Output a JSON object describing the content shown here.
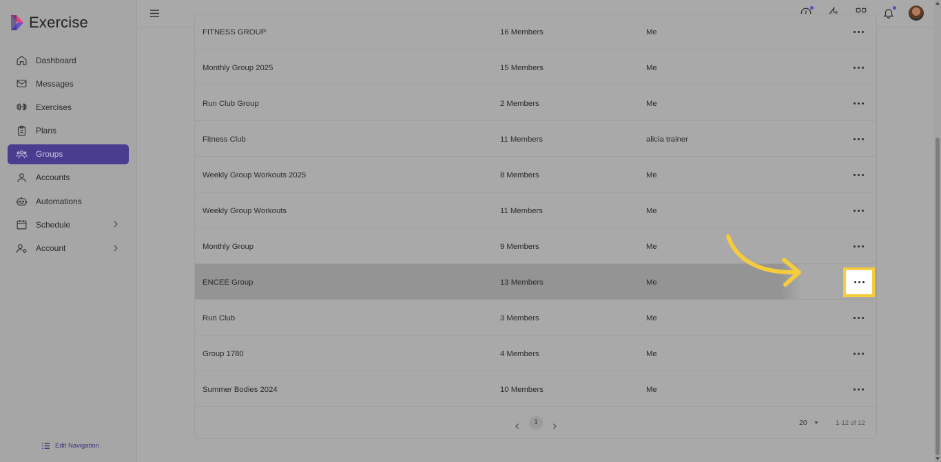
{
  "app": {
    "name": "Exercise"
  },
  "sidebar": {
    "items": [
      {
        "label": "Dashboard",
        "icon": "home-icon"
      },
      {
        "label": "Messages",
        "icon": "mail-icon"
      },
      {
        "label": "Exercises",
        "icon": "dumbbell-icon"
      },
      {
        "label": "Plans",
        "icon": "clipboard-icon"
      },
      {
        "label": "Groups",
        "icon": "users-icon",
        "active": true
      },
      {
        "label": "Accounts",
        "icon": "user-icon"
      },
      {
        "label": "Automations",
        "icon": "robot-icon"
      },
      {
        "label": "Schedule",
        "icon": "calendar-icon",
        "has_submenu": true
      },
      {
        "label": "Account",
        "icon": "user-gear-icon",
        "has_submenu": true
      }
    ],
    "edit_navigation": "Edit Navigation"
  },
  "topbar": {
    "icons": [
      "clock-icon",
      "lightning-icon",
      "apps-grid-icon",
      "bell-icon",
      "avatar"
    ]
  },
  "groups_table": {
    "rows": [
      {
        "name": "FITNESS GROUP",
        "members": "16 Members",
        "owner": "Me"
      },
      {
        "name": "Monthly Group 2025",
        "members": "15 Members",
        "owner": "Me"
      },
      {
        "name": "Run Club Group",
        "members": "2 Members",
        "owner": "Me"
      },
      {
        "name": "Fitness Club",
        "members": "11 Members",
        "owner": "alicia trainer"
      },
      {
        "name": "Weekly Group Workouts 2025",
        "members": "8 Members",
        "owner": "Me"
      },
      {
        "name": "Weekly Group Workouts",
        "members": "11 Members",
        "owner": "Me"
      },
      {
        "name": "Monthly Group",
        "members": "9 Members",
        "owner": "Me"
      },
      {
        "name": "ENCEE Group",
        "members": "13 Members",
        "owner": "Me"
      },
      {
        "name": "Run Club",
        "members": "3 Members",
        "owner": "Me"
      },
      {
        "name": "Group 1780",
        "members": "4 Members",
        "owner": "Me"
      },
      {
        "name": "Summer Bodies 2024",
        "members": "10 Members",
        "owner": "Me"
      }
    ],
    "highlighted_row": 7
  },
  "pagination": {
    "current_page": "1",
    "page_size": "20",
    "range": "1-12 of 12"
  },
  "colors": {
    "accent": "#4a3d8f",
    "highlight": "#f5cc3c"
  }
}
